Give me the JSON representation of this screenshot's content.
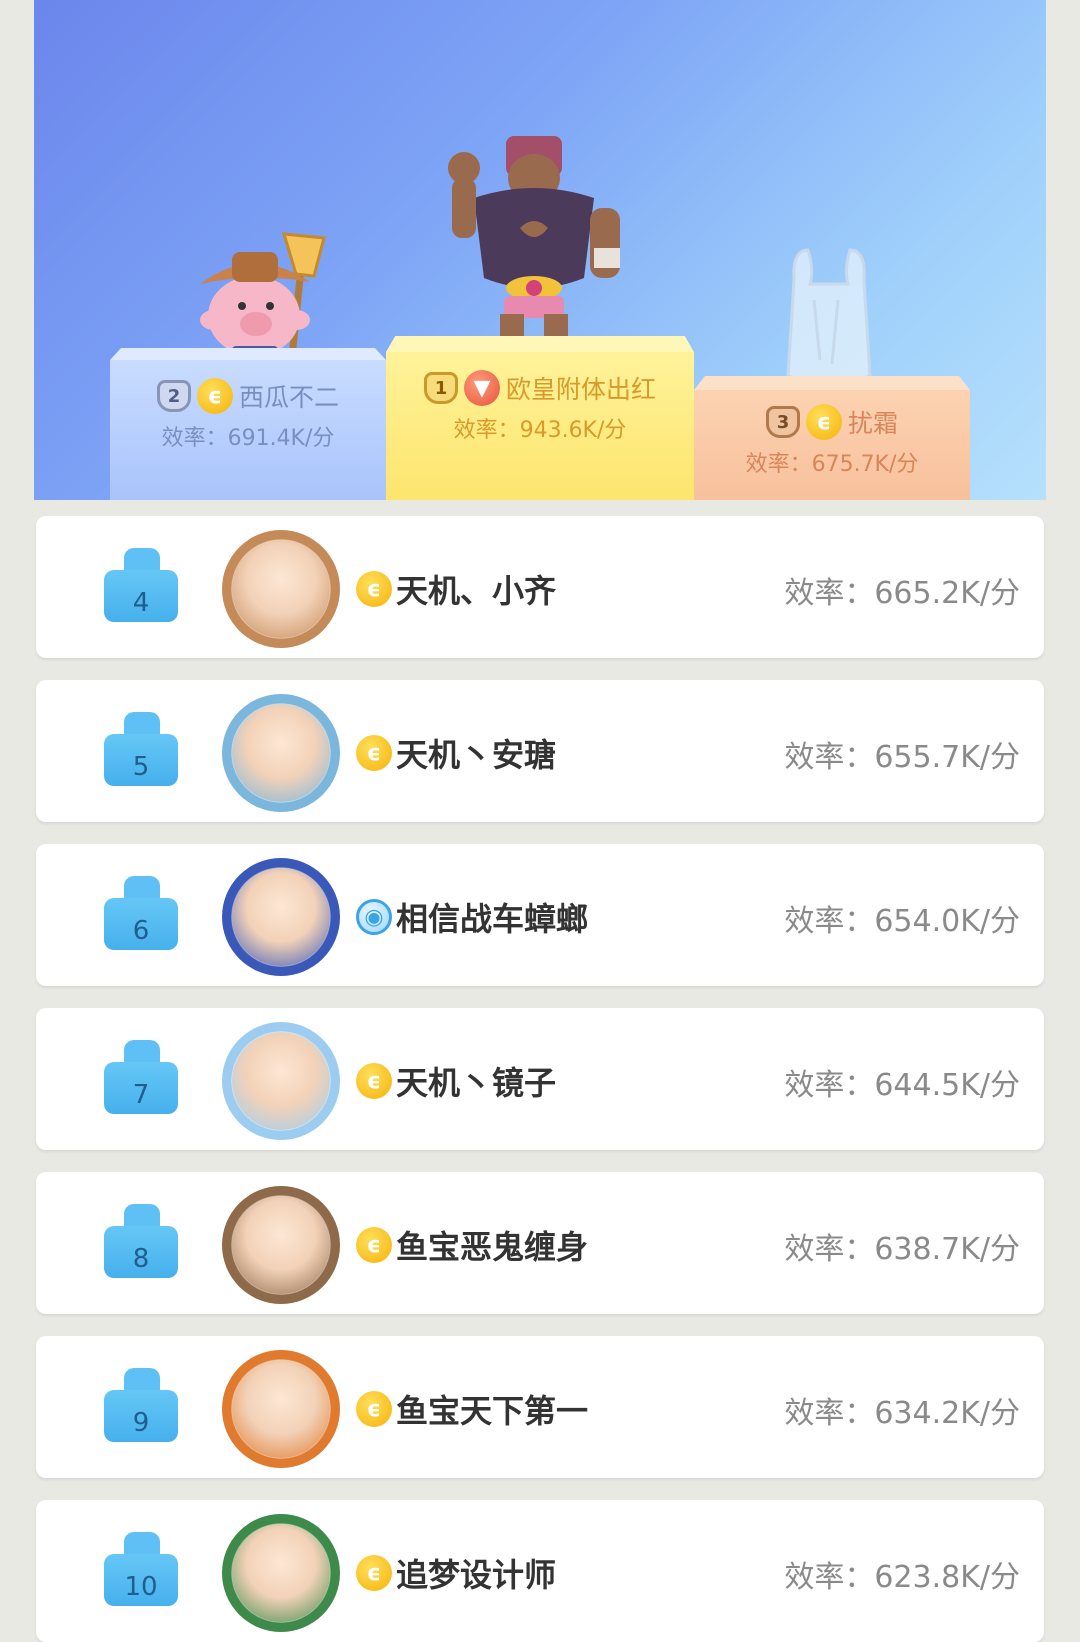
{
  "podium": [
    {
      "rank": "2",
      "name": "西瓜不二",
      "rate": "效率：691.4K/分",
      "character_icon": "pig-cowboy-icon",
      "badge_icon": "coin-icon"
    },
    {
      "rank": "1",
      "name": "欧皇附体出红",
      "rate": "效率：943.6K/分",
      "character_icon": "muscle-man-icon",
      "badge_icon": "red-demon-coin-icon"
    },
    {
      "rank": "3",
      "name": "扰霜",
      "rate": "效率：675.7K/分",
      "character_icon": "plastic-bag-icon",
      "badge_icon": "coin-icon"
    }
  ],
  "rows": [
    {
      "rank": "4",
      "name": "天机、小齐",
      "rate": "效率：665.2K/分",
      "badge": "coin",
      "avatar_color": "#c48a58"
    },
    {
      "rank": "5",
      "name": "天机丶安瑭",
      "rate": "效率：655.7K/分",
      "badge": "coin",
      "avatar_color": "#7bb6dd"
    },
    {
      "rank": "6",
      "name": "相信战车蟑螂",
      "rate": "效率：654.0K/分",
      "badge": "blue",
      "avatar_color": "#3a58b8"
    },
    {
      "rank": "7",
      "name": "天机丶镜子",
      "rate": "效率：644.5K/分",
      "badge": "coin",
      "avatar_color": "#9ccdf0"
    },
    {
      "rank": "8",
      "name": "鱼宝恶鬼缠身",
      "rate": "效率：638.7K/分",
      "badge": "coin",
      "avatar_color": "#8f6a4a"
    },
    {
      "rank": "9",
      "name": "鱼宝天下第一",
      "rate": "效率：634.2K/分",
      "badge": "coin",
      "avatar_color": "#e07a2e"
    },
    {
      "rank": "10",
      "name": "追梦设计师",
      "rate": "效率：623.8K/分",
      "badge": "coin",
      "avatar_color": "#3d8a4a"
    }
  ]
}
